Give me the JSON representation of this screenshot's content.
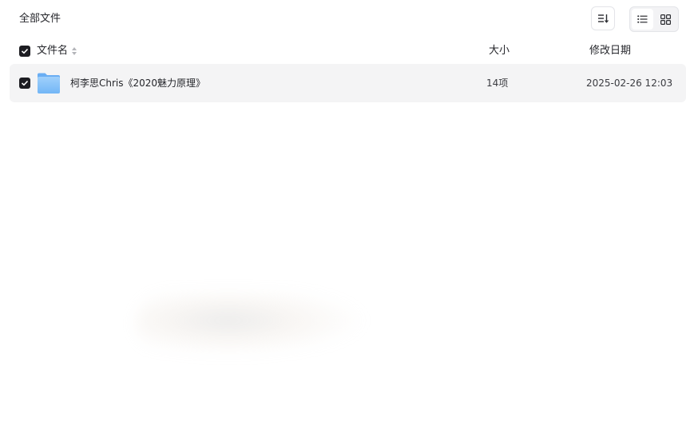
{
  "breadcrumb": {
    "label": "全部文件"
  },
  "toolbar": {
    "sort_icon": "sort-list-icon",
    "list_view_icon": "list-view-icon",
    "grid_view_icon": "grid-view-icon",
    "active_view": "list"
  },
  "table": {
    "columns": {
      "name": "文件名",
      "size": "大小",
      "date": "修改日期"
    },
    "rows": [
      {
        "name": "柯李思Chris《2020魅力原理》",
        "size": "14项",
        "date": "2025-02-26 12:03",
        "checked": true,
        "icon": "folder-icon"
      }
    ]
  },
  "colors": {
    "checkbox": "#1d1d22",
    "row_background": "#f4f4f5",
    "folder_light": "#a9d3fb",
    "folder_dark": "#6fb3f5"
  }
}
